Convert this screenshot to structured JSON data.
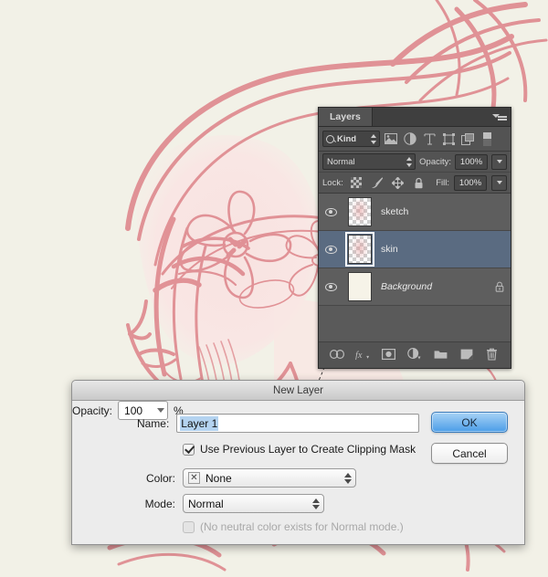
{
  "app": {
    "name": "Adobe Photoshop",
    "canvas_background": "#f2f1e7",
    "artwork_description": "pink rose-colored rough sketch of a girl in profile wearing a flower crown",
    "artwork_ink_color": "#df8b90",
    "artwork_fill_color": "#f7dedd"
  },
  "layers_panel": {
    "tab_label": "Layers",
    "menu_icon": "panel-menu-icon",
    "filter": {
      "search_icon": "magnifier-icon",
      "kind_label": "Kind",
      "stepper_icon": "updown-stepper-icon",
      "filter_icons": [
        "pixel-layer-filter-icon",
        "adjustment-layer-filter-icon",
        "type-layer-filter-icon",
        "shape-layer-filter-icon",
        "smart-object-filter-icon"
      ],
      "toggle_icon": "filter-toggle-switch-icon"
    },
    "blend": {
      "mode_value": "Normal",
      "mode_stepper_icon": "updown-stepper-icon",
      "opacity_label": "Opacity:",
      "opacity_value": "100%",
      "opacity_dropdown_icon": "chevron-down-icon"
    },
    "lock": {
      "label": "Lock:",
      "icons": [
        "lock-transparent-pixels-icon",
        "lock-image-pixels-brush-icon",
        "lock-position-move-icon",
        "lock-all-padlock-icon"
      ],
      "fill_label": "Fill:",
      "fill_value": "100%",
      "fill_dropdown_icon": "chevron-down-icon"
    },
    "layers": [
      {
        "name": "sketch",
        "visible": true,
        "selected": false,
        "thumbnail": "transparent-checkerboard-with-pink-sketch",
        "locked": false,
        "italic": false
      },
      {
        "name": "skin",
        "visible": true,
        "selected": true,
        "thumbnail": "transparent-checkerboard-with-pink-fill",
        "locked": false,
        "italic": false
      },
      {
        "name": "Background",
        "visible": true,
        "selected": false,
        "thumbnail": "solid-cream-color",
        "locked": true,
        "italic": true,
        "lock_icon": "padlock-icon"
      }
    ],
    "bottom_toolbar_icons": [
      "link-layers-icon",
      "layer-style-fx-icon",
      "add-layer-mask-icon",
      "new-fill-adjustment-layer-icon",
      "new-group-icon",
      "new-layer-icon",
      "delete-layer-trash-icon"
    ]
  },
  "new_layer_dialog": {
    "title": "New Layer",
    "name": {
      "label": "Name:",
      "value": "Layer 1",
      "selected": true
    },
    "clipping_mask": {
      "label": "Use Previous Layer to Create Clipping Mask",
      "checked": true
    },
    "color": {
      "label": "Color:",
      "value": "None",
      "swatch_icon": "no-color-x-icon"
    },
    "mode": {
      "label": "Mode:",
      "value": "Normal"
    },
    "opacity": {
      "label": "Opacity:",
      "value": "100",
      "unit": "%"
    },
    "neutral_note": {
      "label": "(No neutral color exists for Normal mode.)",
      "checked": false,
      "disabled": true
    },
    "buttons": {
      "ok": "OK",
      "cancel": "Cancel"
    }
  }
}
